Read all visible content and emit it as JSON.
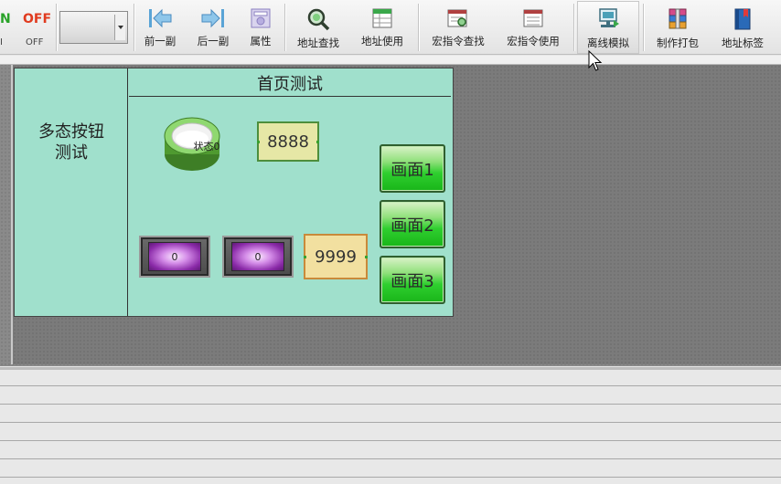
{
  "toolbar": {
    "onoff": {
      "on_text": "N",
      "off_text": "OFF",
      "on_sub": "I",
      "off_sub": "OFF"
    },
    "buttons": [
      {
        "label": "前一副",
        "icon": "arrow-left-bar-icon"
      },
      {
        "label": "后一副",
        "icon": "arrow-right-bar-icon"
      },
      {
        "label": "属性",
        "icon": "properties-icon"
      },
      {
        "label": "地址查找",
        "icon": "magnifier-icon"
      },
      {
        "label": "地址使用",
        "icon": "table-green-icon"
      },
      {
        "label": "宏指令查找",
        "icon": "macro-search-icon"
      },
      {
        "label": "宏指令使用",
        "icon": "macro-use-icon"
      },
      {
        "label": "离线模拟",
        "icon": "offline-simulation-icon"
      },
      {
        "label": "制作打包",
        "icon": "package-icon"
      },
      {
        "label": "地址标签",
        "icon": "address-tag-icon"
      }
    ]
  },
  "hmi": {
    "sidebar_title_line1": "多态按钮",
    "sidebar_title_line2": "测试",
    "page_title": "首页测试",
    "multistate_label": "状态0",
    "numeric1": "8888",
    "numeric2": "9999",
    "lamp1_value": "0",
    "lamp2_value": "0",
    "screen_buttons": [
      "画面1",
      "画面2",
      "画面3"
    ]
  }
}
